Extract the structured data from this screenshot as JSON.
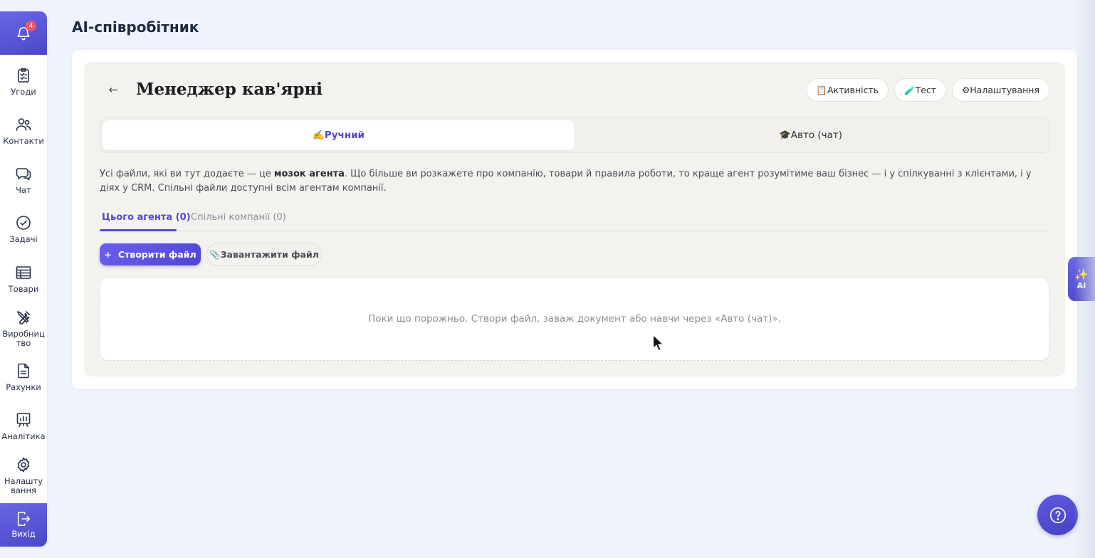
{
  "sidebar": {
    "notification_count": "4",
    "items": [
      {
        "label": "Угоди",
        "icon": "clipboard-icon"
      },
      {
        "label": "Контакти",
        "icon": "users-icon"
      },
      {
        "label": "Чат",
        "icon": "chat-icon"
      },
      {
        "label": "Задачі",
        "icon": "check-circle-icon"
      },
      {
        "label": "Товари",
        "icon": "table-icon"
      },
      {
        "label": "Виробниц тво",
        "icon": "tools-icon"
      },
      {
        "label": "Рахунки",
        "icon": "document-icon"
      },
      {
        "label": "Аналітика",
        "icon": "analytics-icon"
      },
      {
        "label": "Налашту вання",
        "icon": "gear-icon"
      }
    ],
    "exit_label": "Вихід"
  },
  "page": {
    "title": "AI-співробітник"
  },
  "agent": {
    "name": "Менеджер кав'ярні",
    "buttons": {
      "activity": "📋Активність",
      "test": "🧪Тест",
      "settings": "⚙Налаштування"
    },
    "modes": {
      "manual": "✍️Ручний",
      "auto": "🎓Авто (чат)",
      "active": "manual"
    },
    "description_before": "Усі файли, які ви тут додаєте — це ",
    "description_bold": "мозок агента",
    "description_after": ". Що більше ви розкажете про компанію, товари й правила роботи, то краще агент розумітиме ваш бізнес — і у спілкуванні з клієнтами, і у діях у CRM. Спільні файли доступні всім агентам компанії.",
    "tabs": {
      "this_agent": "Цього агента (0)",
      "shared": "Спільні компанії (0)"
    },
    "create_file": "Створити файл",
    "upload_file": "📎Завантажити файл",
    "empty_text": "Поки що порожньо. Створи файл, заваж документ або навчи через «Авто (чат)»."
  },
  "ai_tab": {
    "label": "AI",
    "icon": "sparkles-icon"
  },
  "help": {
    "icon": "question-icon"
  },
  "colors": {
    "accent": "#5448d6",
    "sidebar_gradient": "#4a47c9",
    "background": "#eff3fb",
    "panel": "#f3f2ee"
  }
}
